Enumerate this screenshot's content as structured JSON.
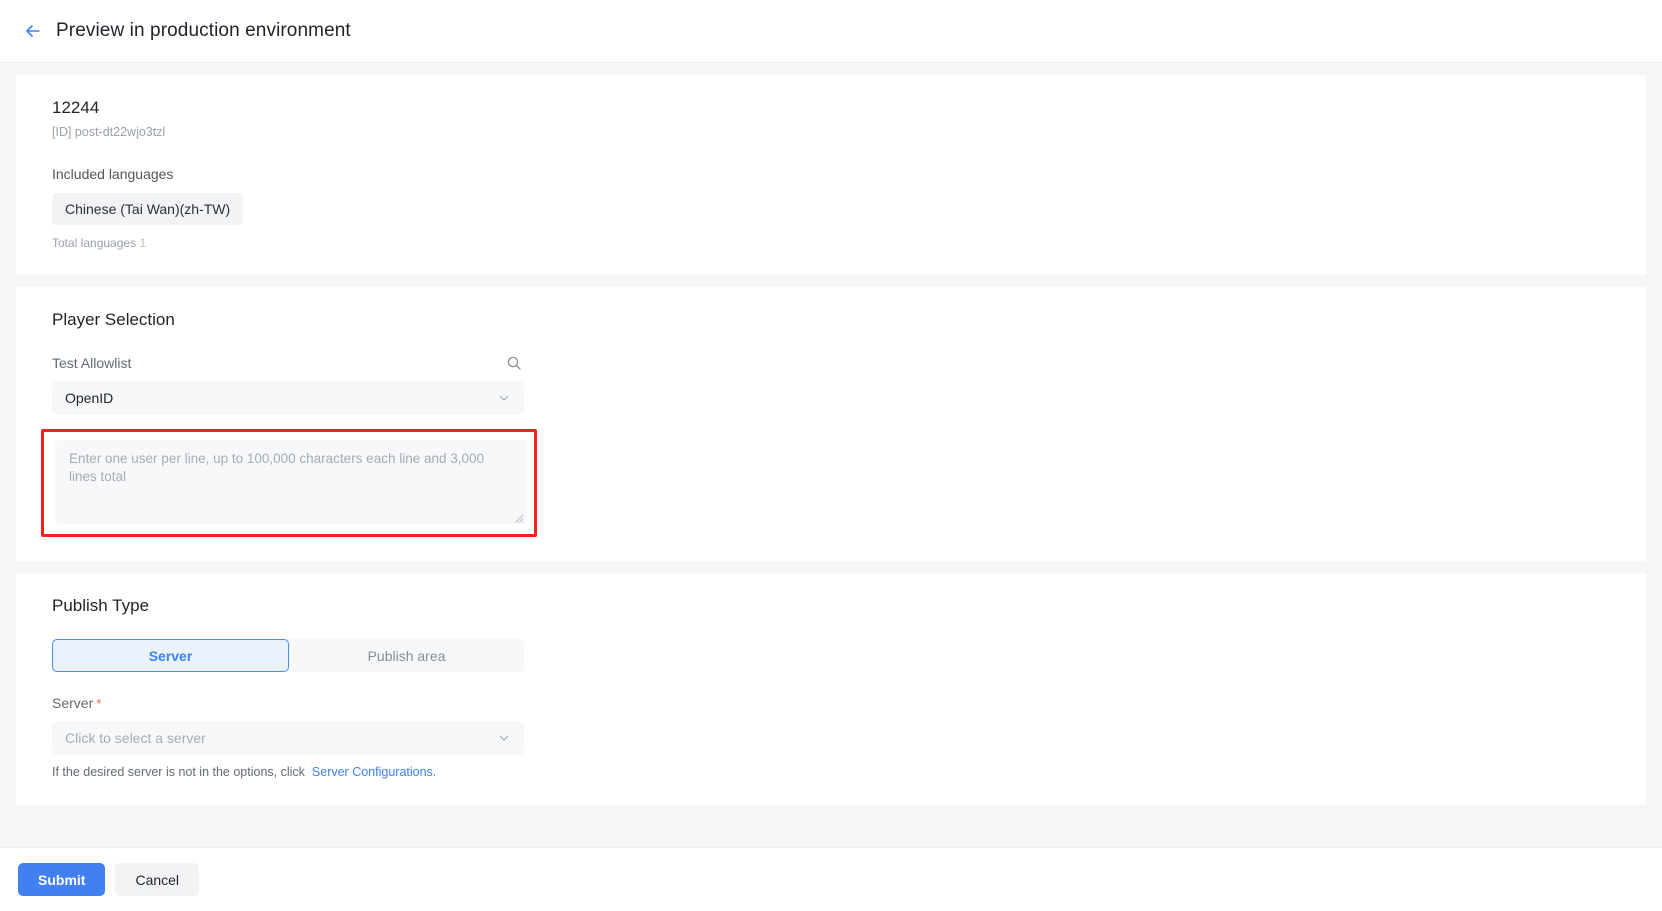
{
  "header": {
    "back_icon": "arrow-left-icon",
    "title": "Preview in production environment"
  },
  "info_card": {
    "item_number": "12244",
    "id_prefix": "[ID]",
    "id_value": "post-dt22wjo3tzl",
    "id_line": "[ID] post-dt22wjo3tzl",
    "included_languages_label": "Included languages",
    "languages": [
      "Chinese (Tai Wan)(zh-TW)"
    ],
    "total_languages_label": "Total languages",
    "total_languages_count": "1"
  },
  "player_selection": {
    "heading": "Player Selection",
    "allowlist_label": "Test Allowlist",
    "search_icon": "search-icon",
    "id_type_select": {
      "value": "OpenID",
      "chevron": "chevron-down-icon"
    },
    "users_textarea": {
      "placeholder": "Enter one user per line, up to 100,000 characters each line and 3,000 lines total",
      "value": "",
      "highlight_color": "#f5221d"
    }
  },
  "publish_type": {
    "heading": "Publish Type",
    "tabs": [
      {
        "label": "Server",
        "active": true
      },
      {
        "label": "Publish area",
        "active": false
      }
    ],
    "server_field": {
      "label": "Server",
      "required_marker": "*",
      "placeholder": "Click to select a server",
      "chevron": "chevron-down-icon"
    },
    "hint_text": "If the desired server is not in the options, click",
    "hint_link": "Server Configurations."
  },
  "footer": {
    "submit_label": "Submit",
    "cancel_label": "Cancel"
  },
  "colors": {
    "accent_blue": "#4080f0",
    "link_blue": "#3b82f6",
    "highlight_red": "#f5221d",
    "required_red": "#f5574c",
    "page_bg": "#f5f6f7",
    "card_bg": "#ffffff",
    "field_bg": "#f7f8fa"
  }
}
